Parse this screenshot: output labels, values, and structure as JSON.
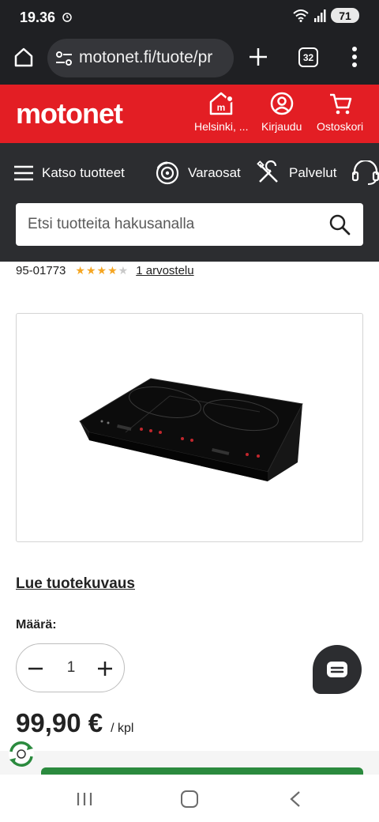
{
  "status_bar": {
    "time": "19.36",
    "battery": "71"
  },
  "browser": {
    "url": "motonet.fi/tuote/pr",
    "tab_count": "32"
  },
  "header": {
    "logo": "motonet",
    "store_label": "Helsinki, ...",
    "login_label": "Kirjaudu",
    "cart_label": "Ostoskori"
  },
  "nav": {
    "browse_label": "Katso tuotteet",
    "parts_label": "Varaosat",
    "services_label": "Palvelut"
  },
  "search": {
    "placeholder": "Etsi tuotteita hakusanalla"
  },
  "product": {
    "sku": "95-01773",
    "rating": 4,
    "rating_max": 5,
    "reviews_label": "1 arvostelu",
    "description_link": "Lue tuotekuvaus",
    "quantity_label": "Määrä:",
    "quantity": "1",
    "price": "99,90 €",
    "unit": "/ kpl"
  },
  "colors": {
    "brand_red": "#e31e24",
    "dark": "#2c2d30",
    "star": "#f5a623",
    "cta_green": "#2b8a3e"
  }
}
